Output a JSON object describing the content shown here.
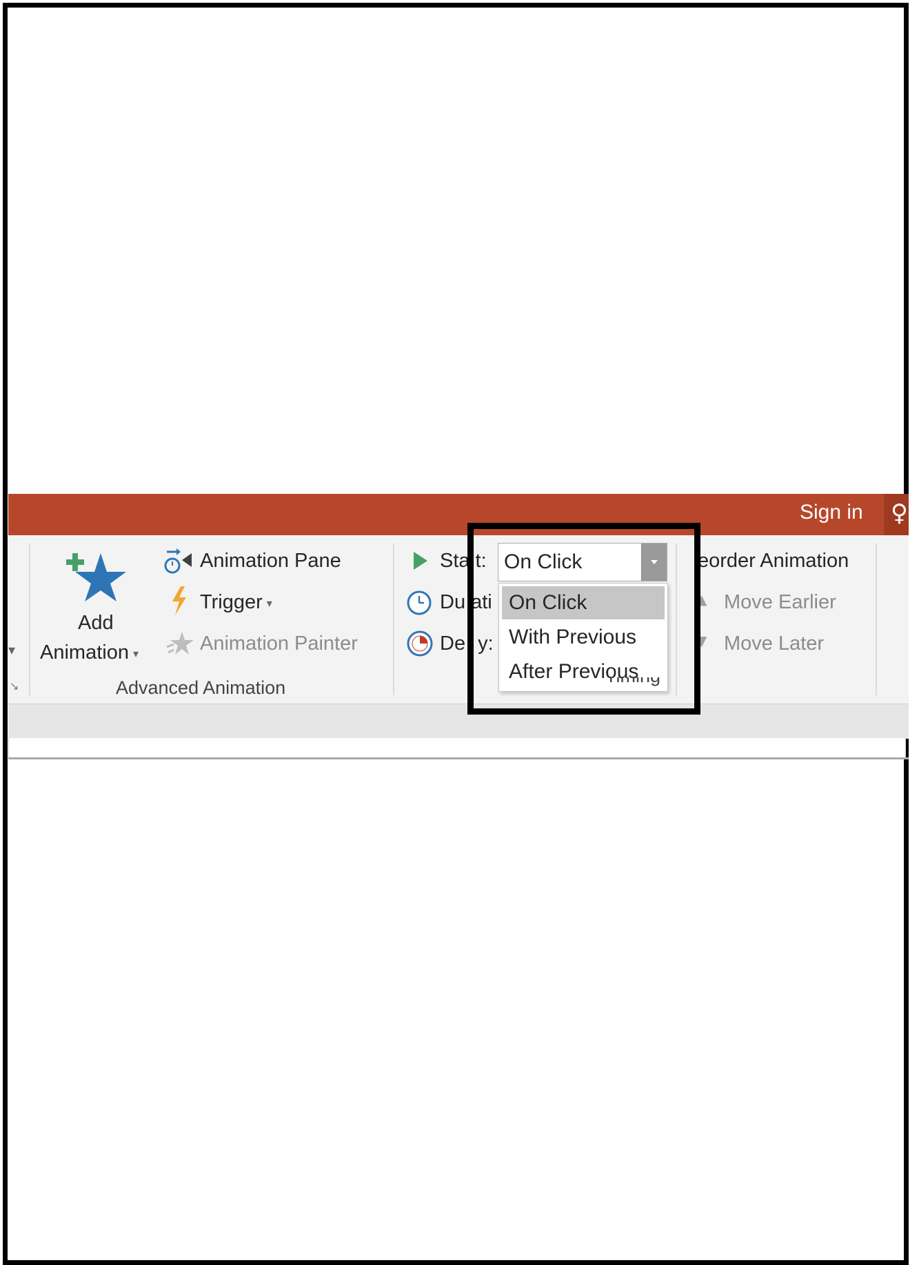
{
  "titlebar": {
    "sign_in": "Sign in",
    "accent": "#b7472a"
  },
  "advanced_animation": {
    "add_animation_line1": "Add",
    "add_animation_line2": "Animation",
    "animation_pane": "Animation Pane",
    "trigger": "Trigger",
    "animation_painter": "Animation Painter",
    "group_label": "Advanced Animation"
  },
  "timing": {
    "start_label_a": "Sta",
    "start_label_b": "t:",
    "duration_label": "Du",
    "duration_label_b": "ati",
    "delay_label_a": "De",
    "delay_label_b": "y:",
    "start_value": "On Click",
    "group_label_partial": "Timing"
  },
  "dropdown": {
    "options": [
      "On Click",
      "With Previous",
      "After Previous"
    ],
    "selected_index": 0
  },
  "reorder": {
    "title": "eorder Animation",
    "move_earlier": "Move Earlier",
    "move_later": "Move Later"
  },
  "icons": {
    "add_animation": "star-plus-icon",
    "animation_pane": "animation-pane-icon",
    "trigger": "lightning-icon",
    "painter": "painter-star-icon",
    "start": "play-icon",
    "duration": "clock-icon",
    "delay": "delay-clock-icon",
    "user": "user-icon"
  }
}
